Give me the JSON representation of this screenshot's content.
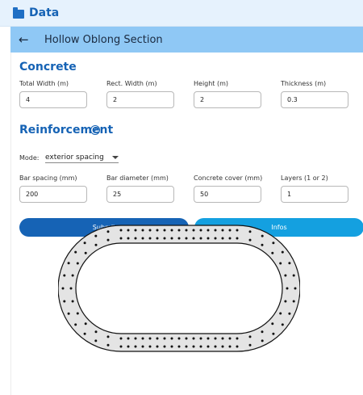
{
  "data_bar": {
    "title": "Data",
    "icon": "folder-icon"
  },
  "header": {
    "title": "Hollow Oblong Section",
    "back_icon": "arrow-left-icon"
  },
  "concrete": {
    "title": "Concrete",
    "fields": [
      {
        "label": "Total Width (m)",
        "value": "4"
      },
      {
        "label": "Rect. Width (m)",
        "value": "2"
      },
      {
        "label": "Height (m)",
        "value": "2"
      },
      {
        "label": "Thickness (m)",
        "value": "0.3"
      }
    ]
  },
  "reinforcement": {
    "title": "Reinforcement",
    "help_icon": "help-circle-icon",
    "mode_label": "Mode:",
    "mode_value": "exterior spacing",
    "fields": [
      {
        "label": "Bar spacing (mm)",
        "value": "200"
      },
      {
        "label": "Bar diameter (mm)",
        "value": "25"
      },
      {
        "label": "Concrete cover (mm)",
        "value": "50"
      },
      {
        "label": "Layers (1 or 2)",
        "value": "1"
      }
    ]
  },
  "buttons": {
    "submit": "Submit",
    "infos": "Infos"
  },
  "colors": {
    "primary": "#1663b5",
    "header_bg": "#8fc8f5",
    "infos": "#14a0e0",
    "data_bar_bg": "#e6f2fd",
    "section_fill": "#e4e4e4"
  }
}
